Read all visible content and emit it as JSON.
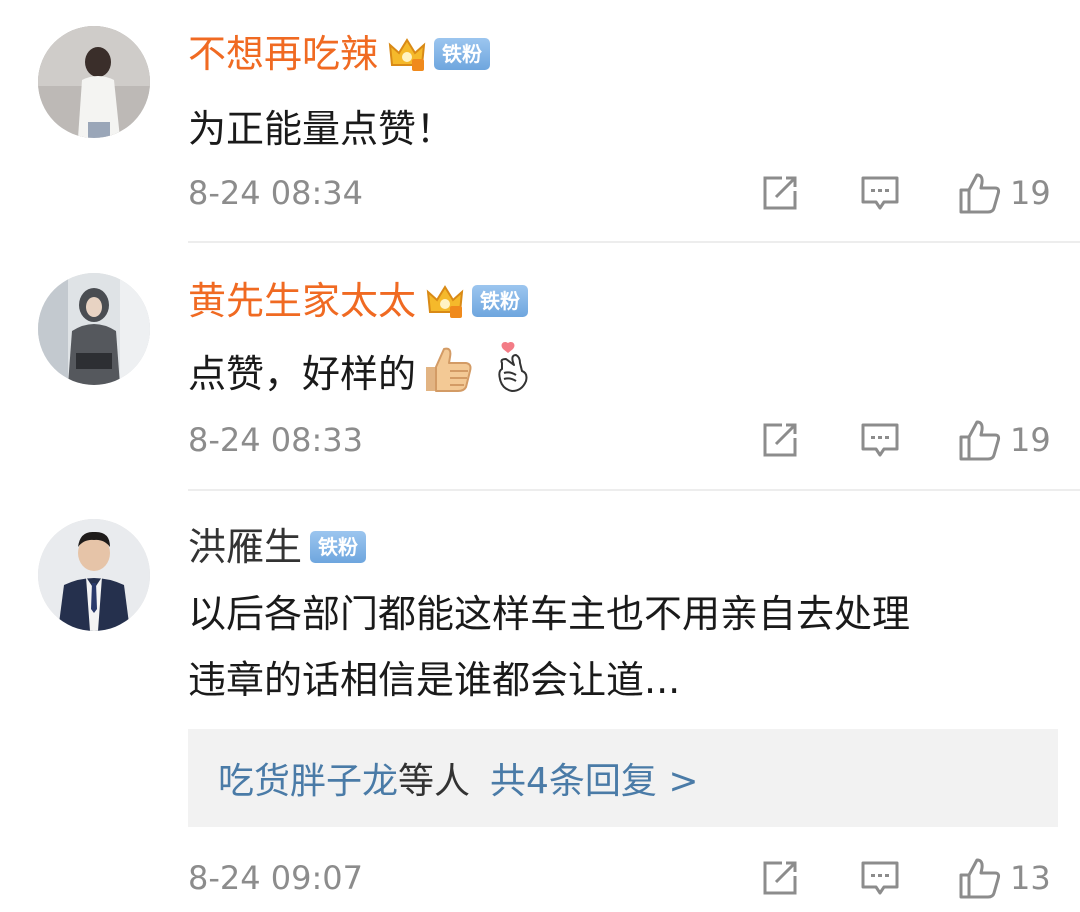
{
  "comments": [
    {
      "username": "不想再吃辣",
      "badge": "铁粉",
      "text": "为正能量点赞！",
      "time": "8-24 08:34",
      "likes": "19",
      "crown": true,
      "avatar": "avatar-girl-white-top"
    },
    {
      "username": "黄先生家太太",
      "badge": "铁粉",
      "text": "点赞，好样的",
      "emojis": [
        "thumbs-up-emoji",
        "finger-heart-emoji"
      ],
      "time": "8-24 08:33",
      "likes": "19",
      "crown": true,
      "avatar": "avatar-hooded-person"
    },
    {
      "username": "洪雁生",
      "badge": "铁粉",
      "text_line1": "以后各部门都能这样车主也不用亲自去处理",
      "text_line2": "违章的话相信是谁都会让道...",
      "reply_users": "吃货胖子龙",
      "reply_mid": "等人",
      "reply_total": "共4条回复 >",
      "time": "8-24 09:07",
      "likes": "13",
      "crown": false,
      "avatar": "avatar-man-suit"
    }
  ],
  "colors": {
    "vip_name": "#f06a22",
    "badge": "#7aaee3",
    "meta_gray": "#8c8c8c",
    "link_blue": "#4a7ba7"
  }
}
